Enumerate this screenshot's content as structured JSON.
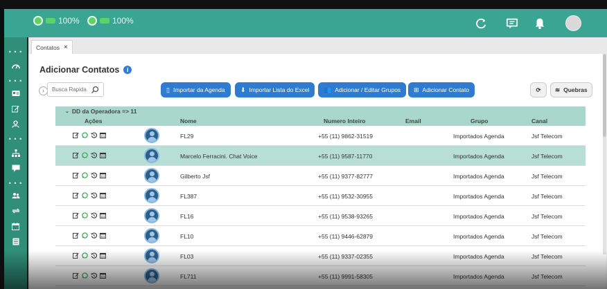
{
  "header": {
    "indicators": [
      {
        "value": "100%"
      },
      {
        "value": "100%"
      }
    ],
    "icons": [
      "refresh-icon",
      "chat-icon",
      "bell-icon",
      "user-avatar"
    ]
  },
  "sidebar": {
    "items": [
      "dots",
      "speedometer-icon",
      "dots",
      "id-card-icon",
      "edit-icon",
      "user-icon",
      "dots",
      "sitemap-icon",
      "message-icon",
      "dots",
      "users-icon",
      "sync-icon",
      "calendar-icon",
      "list-icon"
    ]
  },
  "tabs": [
    {
      "label": "Contatos",
      "close": "×"
    }
  ],
  "page": {
    "title": "Adicionar Contatos",
    "search_placeholder": "Busca Rapida",
    "buttons": {
      "import_agenda": "Importar da Agenda",
      "import_excel": "Importar Lista do Excel",
      "groups": "Adicionar / Editar Grupos",
      "add_contact": "Adicionar Contato",
      "quebras": "Quebras"
    }
  },
  "table": {
    "group_label": "DD da Operadora => 11",
    "headers": {
      "actions": "Ações",
      "name": "Nome",
      "phone": "Numero Inteiro",
      "email": "Email",
      "group": "Grupo",
      "channel": "Canal"
    },
    "rows": [
      {
        "name": "FL29",
        "phone": "+55 (11) 9862-31519",
        "email": "",
        "group": "Importados Agenda",
        "channel": "Jsf Telecom",
        "selected": false
      },
      {
        "name": "Marcelo Ferracini. Chat Voice",
        "phone": "+55 (11) 9587-11770",
        "email": "",
        "group": "Importados Agenda",
        "channel": "Jsf Telecom",
        "selected": true
      },
      {
        "name": "Gilberto Jsf",
        "phone": "+55 (11) 9377-82777",
        "email": "",
        "group": "Importados Agenda",
        "channel": "Jsf Telecom",
        "selected": false
      },
      {
        "name": "FL387",
        "phone": "+55 (11) 9532-30955",
        "email": "",
        "group": "Importados Agenda",
        "channel": "Jsf Telecom",
        "selected": false
      },
      {
        "name": "FL16",
        "phone": "+55 (11) 9538-93265",
        "email": "",
        "group": "Importados Agenda",
        "channel": "Jsf Telecom",
        "selected": false
      },
      {
        "name": "FL10",
        "phone": "+55 (11) 9446-62879",
        "email": "",
        "group": "Importados Agenda",
        "channel": "Jsf Telecom",
        "selected": false
      },
      {
        "name": "FL03",
        "phone": "+55 (11) 9337-02355",
        "email": "",
        "group": "Importados Agenda",
        "channel": "Jsf Telecom",
        "selected": false
      },
      {
        "name": "FL711",
        "phone": "+55 (11) 9991-58305",
        "email": "",
        "group": "Importados Agenda",
        "channel": "Jsf Telecom",
        "selected": false
      }
    ]
  }
}
